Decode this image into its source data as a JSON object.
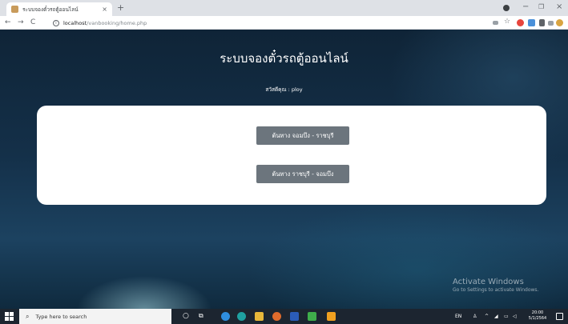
{
  "browser": {
    "tab_title": "ระบบจองตั๋วรถตู้ออนไลน์",
    "tab_close": "×",
    "new_tab": "+",
    "url_host": "localhost",
    "url_path": "/vanbooking/home.php",
    "back": "←",
    "forward": "→",
    "reload": "C",
    "minimize": "−",
    "maximize": "❐",
    "close": "×"
  },
  "page": {
    "site_title": "ระบบจองตั๋วรถตู้ออนไลน์",
    "greeting": "สวัสดีคุณ : ploy",
    "routes": [
      {
        "label": "ต้นทาง จอมบึง - ราชบุรี"
      },
      {
        "label": "ต้นทาง ราชบุรี - จอมบึง"
      }
    ]
  },
  "watermark": {
    "line1": "Activate Windows",
    "line2": "Go to Settings to activate Windows."
  },
  "taskbar": {
    "search_placeholder": "Type here to search",
    "language": "EN",
    "time": "20:00",
    "date": "5/1/2564"
  },
  "colors": {
    "button_gray": "#6c757d",
    "page_bg": "#143049",
    "card_bg": "#ffffff"
  }
}
